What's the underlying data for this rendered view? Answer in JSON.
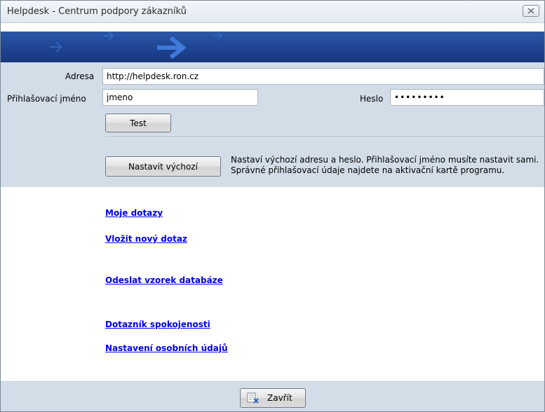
{
  "window": {
    "title": "Helpdesk - Centrum podpory zákazníků",
    "close_icon": "close-x-icon"
  },
  "banner": {
    "colors": {
      "background": "#1b3f8c",
      "arrows": "#3f7ad9"
    },
    "icon": "arrow-right-icon"
  },
  "settings": {
    "address_label": "Adresa",
    "address_value": "http://helpdesk.ron.cz",
    "username_label": "Přihlašovací jméno",
    "username_value": "jmeno",
    "password_label": "Heslo",
    "password_value": "•••••••••",
    "test_button": "Test",
    "defaults_button": "Nastavit výchozí",
    "info_text": "Nastaví výchozí adresu a heslo. Přihlašovací jméno musíte nastavit sami. Správné přihlašovací údaje najdete na aktivační kartě programu."
  },
  "links": {
    "my_queries": "Moje dotazy",
    "new_query": "Vložit nový dotaz",
    "send_sample": "Odeslat vzorek databáze",
    "satisfaction": "Dotazník spokojenosti",
    "personal_settings": "Nastavení osobních údajů"
  },
  "footer": {
    "close_button": "Zavřít",
    "close_icon": "document-close-icon"
  }
}
